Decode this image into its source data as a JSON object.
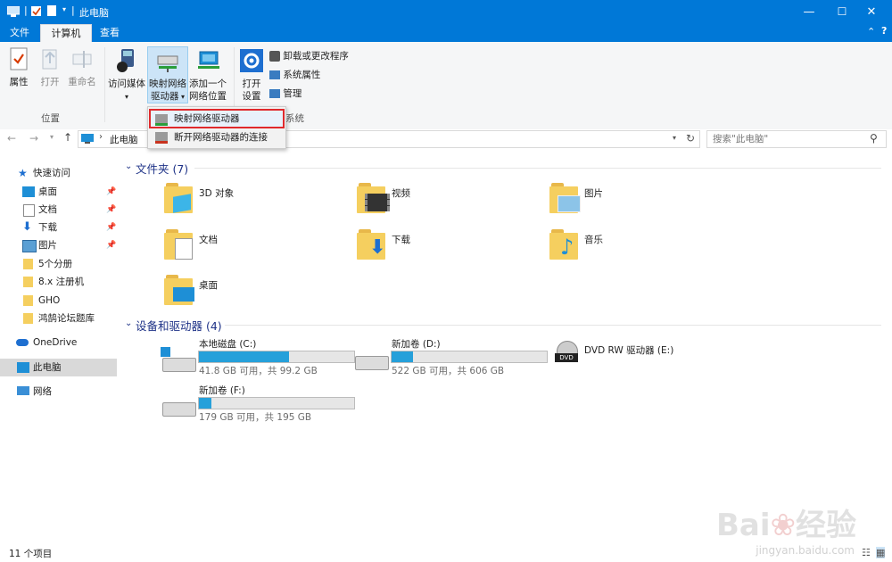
{
  "window": {
    "title": "此电脑",
    "minimize": "—",
    "maximize": "☐",
    "close": "✕"
  },
  "tabs": [
    {
      "label": "文件"
    },
    {
      "label": "计算机"
    },
    {
      "label": "查看"
    }
  ],
  "ribbon": {
    "location": {
      "group": "位置",
      "properties": "属性",
      "open": "打开",
      "rename": "重命名"
    },
    "network": {
      "media_l1": "访问媒体",
      "map_l1": "映射网络",
      "map_l2": "驱动器",
      "add_l1": "添加一个",
      "add_l2": "网络位置"
    },
    "system": {
      "settings_l1": "打开",
      "settings_l2": "设置",
      "uninstall": "卸载或更改程序",
      "sysprops": "系统属性",
      "manage": "管理",
      "group": "系统"
    }
  },
  "dropdown": {
    "map_drive": "映射网络驱动器",
    "disconnect": "断开网络驱动器的连接"
  },
  "address": {
    "path": "此电脑",
    "search_placeholder": "搜索\"此电脑\""
  },
  "sidebar": {
    "quick_access": "快速访问",
    "items": [
      {
        "label": "桌面"
      },
      {
        "label": "文档"
      },
      {
        "label": "下载"
      },
      {
        "label": "图片"
      },
      {
        "label": "5个分册"
      },
      {
        "label": "8.x 注册机"
      },
      {
        "label": "GHO"
      },
      {
        "label": "鸿鹄论坛题库"
      }
    ],
    "onedrive": "OneDrive",
    "this_pc": "此电脑",
    "network": "网络"
  },
  "folders_section": "文件夹 (7)",
  "folders": [
    {
      "label": "3D 对象"
    },
    {
      "label": "视频"
    },
    {
      "label": "图片"
    },
    {
      "label": "文档"
    },
    {
      "label": "下载"
    },
    {
      "label": "音乐"
    },
    {
      "label": "桌面"
    }
  ],
  "devices_section": "设备和驱动器 (4)",
  "drives": [
    {
      "label": "本地磁盘 (C:)",
      "free": "41.8 GB 可用，共 99.2 GB",
      "used_fraction": 0.58
    },
    {
      "label": "新加卷 (D:)",
      "free": "522 GB 可用，共 606 GB",
      "used_fraction": 0.14
    },
    {
      "label": "DVD RW 驱动器 (E:)"
    },
    {
      "label": "新加卷 (F:)",
      "free": "179 GB 可用，共 195 GB",
      "used_fraction": 0.08
    }
  ],
  "status": {
    "count": "11 个项目"
  },
  "watermark": {
    "brand": "Bai du 经验",
    "url": "jingyan.baidu.com"
  },
  "colors": {
    "accent": "#0078d7",
    "bar_fill": "#26a0da",
    "highlight_border": "#e0292c"
  }
}
